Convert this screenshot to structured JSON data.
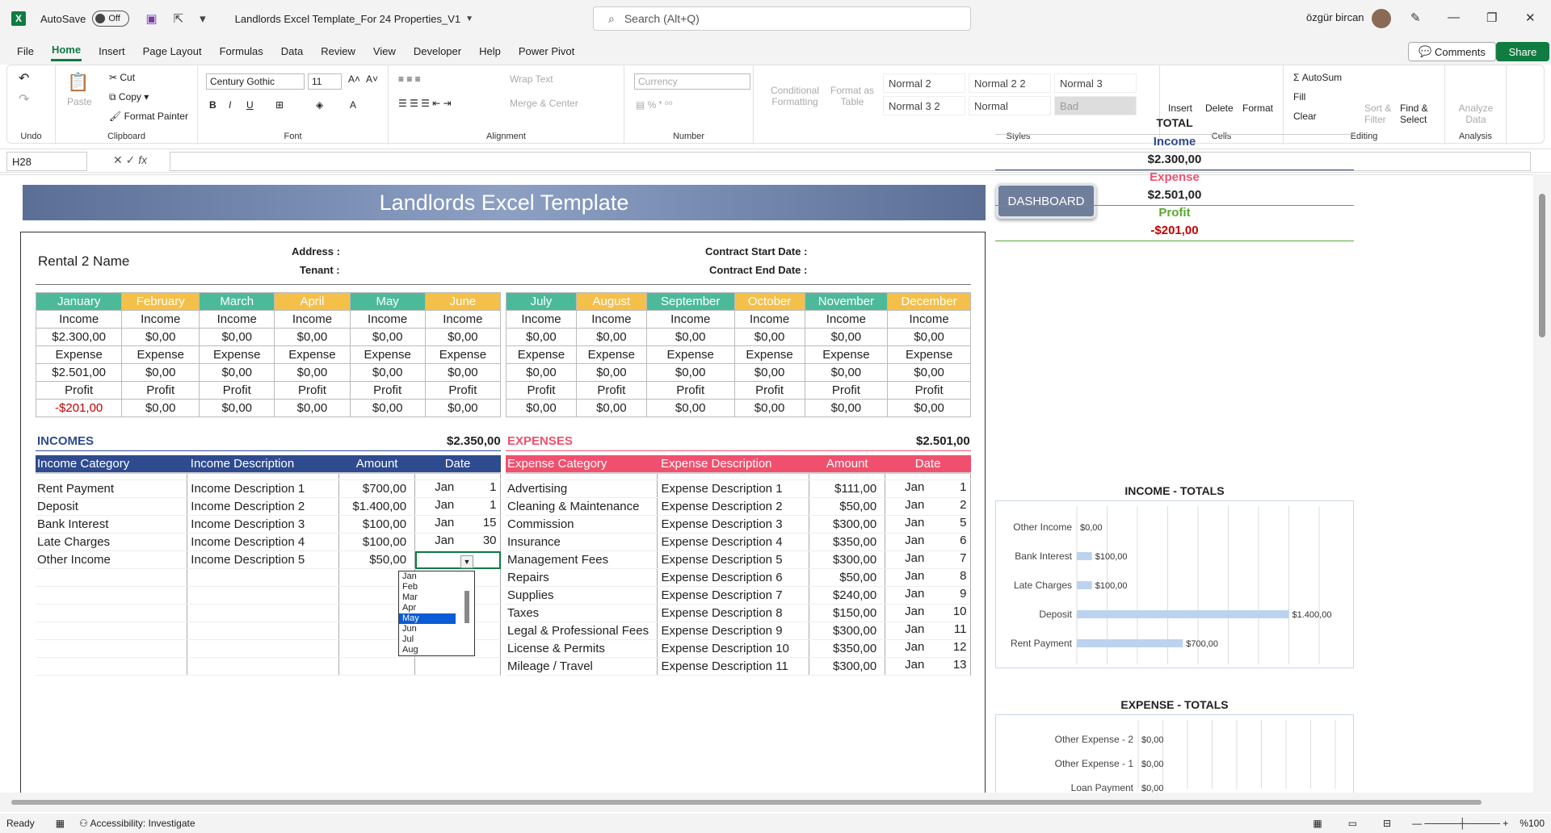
{
  "titlebar": {
    "autosave_label": "AutoSave",
    "autosave_state": "Off",
    "doc_title": "Landlords Excel Template_For 24 Properties_V1",
    "search_placeholder": "Search (Alt+Q)",
    "user_name": "özgür bircan"
  },
  "menu": {
    "items": [
      "File",
      "Home",
      "Insert",
      "Page Layout",
      "Formulas",
      "Data",
      "Review",
      "View",
      "Developer",
      "Help",
      "Power Pivot"
    ],
    "comments": "Comments",
    "share": "Share"
  },
  "ribbon": {
    "undo_group": "Undo",
    "clipboard": {
      "label": "Clipboard",
      "paste": "Paste",
      "cut": "Cut",
      "copy": "Copy",
      "format_painter": "Format Painter"
    },
    "font": {
      "label": "Font",
      "family": "Century Gothic",
      "size": "11"
    },
    "alignment": {
      "label": "Alignment",
      "wrap": "Wrap Text",
      "merge": "Merge & Center"
    },
    "number": {
      "label": "Number",
      "format": "Currency"
    },
    "styles": {
      "label": "Styles",
      "conditional": "Conditional Formatting",
      "format_table": "Format as Table",
      "cells": [
        "Normal 2",
        "Normal 2 2",
        "Normal 3",
        "Normal 3 2",
        "Normal",
        "Bad"
      ]
    },
    "cells": {
      "label": "Cells",
      "insert": "Insert",
      "delete": "Delete",
      "format": "Format"
    },
    "editing": {
      "label": "Editing",
      "autosum": "AutoSum",
      "fill": "Fill",
      "clear": "Clear",
      "sort": "Sort & Filter",
      "find": "Find & Select"
    },
    "analysis": {
      "label": "Analysis",
      "analyze": "Analyze Data"
    }
  },
  "formula_bar": {
    "cell_ref": "H28",
    "fx": "fx"
  },
  "sheet": {
    "banner": "Landlords Excel Template",
    "dashboard": "DASHBOARD",
    "rental_name": "Rental 2 Name",
    "address_label": "Address :",
    "tenant_label": "Tenant :",
    "contract_start_label": "Contract Start Date :",
    "contract_end_label": "Contract End Date :",
    "months_h1": [
      "January",
      "February",
      "March",
      "April",
      "May",
      "June"
    ],
    "months_h2": [
      "July",
      "August",
      "September",
      "October",
      "November",
      "December"
    ],
    "row_labels": {
      "income": "Income",
      "expense": "Expense",
      "profit": "Profit"
    },
    "h1_income": [
      "$2.300,00",
      "$0,00",
      "$0,00",
      "$0,00",
      "$0,00",
      "$0,00"
    ],
    "h1_expense": [
      "$2.501,00",
      "$0,00",
      "$0,00",
      "$0,00",
      "$0,00",
      "$0,00"
    ],
    "h1_profit": [
      "-$201,00",
      "$0,00",
      "$0,00",
      "$0,00",
      "$0,00",
      "$0,00"
    ],
    "h2_income": [
      "$0,00",
      "$0,00",
      "$0,00",
      "$0,00",
      "$0,00",
      "$0,00"
    ],
    "h2_expense": [
      "$0,00",
      "$0,00",
      "$0,00",
      "$0,00",
      "$0,00",
      "$0,00"
    ],
    "h2_profit": [
      "$0,00",
      "$0,00",
      "$0,00",
      "$0,00",
      "$0,00",
      "$0,00"
    ],
    "incomes_title": "INCOMES",
    "incomes_total": "$2.350,00",
    "income_headers": [
      "Income Category",
      "Income Description",
      "Amount",
      "Date"
    ],
    "income_rows": [
      [
        "Rent Payment",
        "Income Description 1",
        "$700,00",
        "Jan",
        "1"
      ],
      [
        "Deposit",
        "Income Description 2",
        "$1.400,00",
        "Jan",
        "1"
      ],
      [
        "Bank Interest",
        "Income Description 3",
        "$100,00",
        "Jan",
        "15"
      ],
      [
        "Late Charges",
        "Income Description 4",
        "$100,00",
        "Jan",
        "30"
      ],
      [
        "Other Income",
        "Income Description 5",
        "$50,00",
        "",
        ""
      ]
    ],
    "expenses_title": "EXPENSES",
    "expenses_total": "$2.501,00",
    "expense_headers": [
      "Expense Category",
      "Expense Description",
      "Amount",
      "Date"
    ],
    "expense_rows": [
      [
        "Advertising",
        "Expense Description 1",
        "$111,00",
        "Jan",
        "1"
      ],
      [
        "Cleaning & Maintenance",
        "Expense Description 2",
        "$50,00",
        "Jan",
        "2"
      ],
      [
        "Commission",
        "Expense Description 3",
        "$300,00",
        "Jan",
        "5"
      ],
      [
        "Insurance",
        "Expense Description 4",
        "$350,00",
        "Jan",
        "6"
      ],
      [
        "Management Fees",
        "Expense Description 5",
        "$300,00",
        "Jan",
        "7"
      ],
      [
        "Repairs",
        "Expense Description 6",
        "$50,00",
        "Jan",
        "8"
      ],
      [
        "Supplies",
        "Expense Description 7",
        "$240,00",
        "Jan",
        "9"
      ],
      [
        "Taxes",
        "Expense Description 8",
        "$150,00",
        "Jan",
        "10"
      ],
      [
        "Legal & Professional Fees",
        "Expense Description 9",
        "$300,00",
        "Jan",
        "11"
      ],
      [
        "License & Permits",
        "Expense Description 10",
        "$350,00",
        "Jan",
        "12"
      ],
      [
        "Mileage / Travel",
        "Expense Description 11",
        "$300,00",
        "Jan",
        "13"
      ]
    ],
    "dropdown_options": [
      "Jan",
      "Feb",
      "Mar",
      "Apr",
      "May",
      "Jun",
      "Jul",
      "Aug"
    ],
    "dropdown_selected": "May",
    "total": {
      "title": "TOTAL",
      "income_label": "Income",
      "income": "$2.300,00",
      "expense_label": "Expense",
      "expense": "$2.501,00",
      "profit_label": "Profit",
      "profit": "-$201,00"
    }
  },
  "colors": {
    "green": "#4cba9a",
    "yellow": "#f4c04a",
    "income_blue": "#2f4b8f",
    "expense_red": "#f0506e",
    "excel_green": "#107c41"
  },
  "chart_data": [
    {
      "type": "bar",
      "title": "INCOME - TOTALS",
      "orientation": "horizontal",
      "categories": [
        "Other Income",
        "Bank Interest",
        "Late Charges",
        "Deposit",
        "Rent Payment"
      ],
      "values": [
        0,
        100,
        100,
        1400,
        700
      ],
      "labels": [
        "$0,00",
        "$100,00",
        "$100,00",
        "$1.400,00",
        "$700,00"
      ],
      "xlim": [
        0,
        1600
      ],
      "grid": true
    },
    {
      "type": "bar",
      "title": "EXPENSE - TOTALS",
      "orientation": "horizontal",
      "categories": [
        "Other Expense - 2",
        "Other Expense - 1",
        "Loan Payment"
      ],
      "values": [
        0,
        0,
        0
      ],
      "labels": [
        "$0,00",
        "$0,00",
        "$0,00"
      ],
      "grid": true
    }
  ],
  "status": {
    "ready": "Ready",
    "accessibility": "Accessibility: Investigate",
    "zoom": "%100"
  }
}
